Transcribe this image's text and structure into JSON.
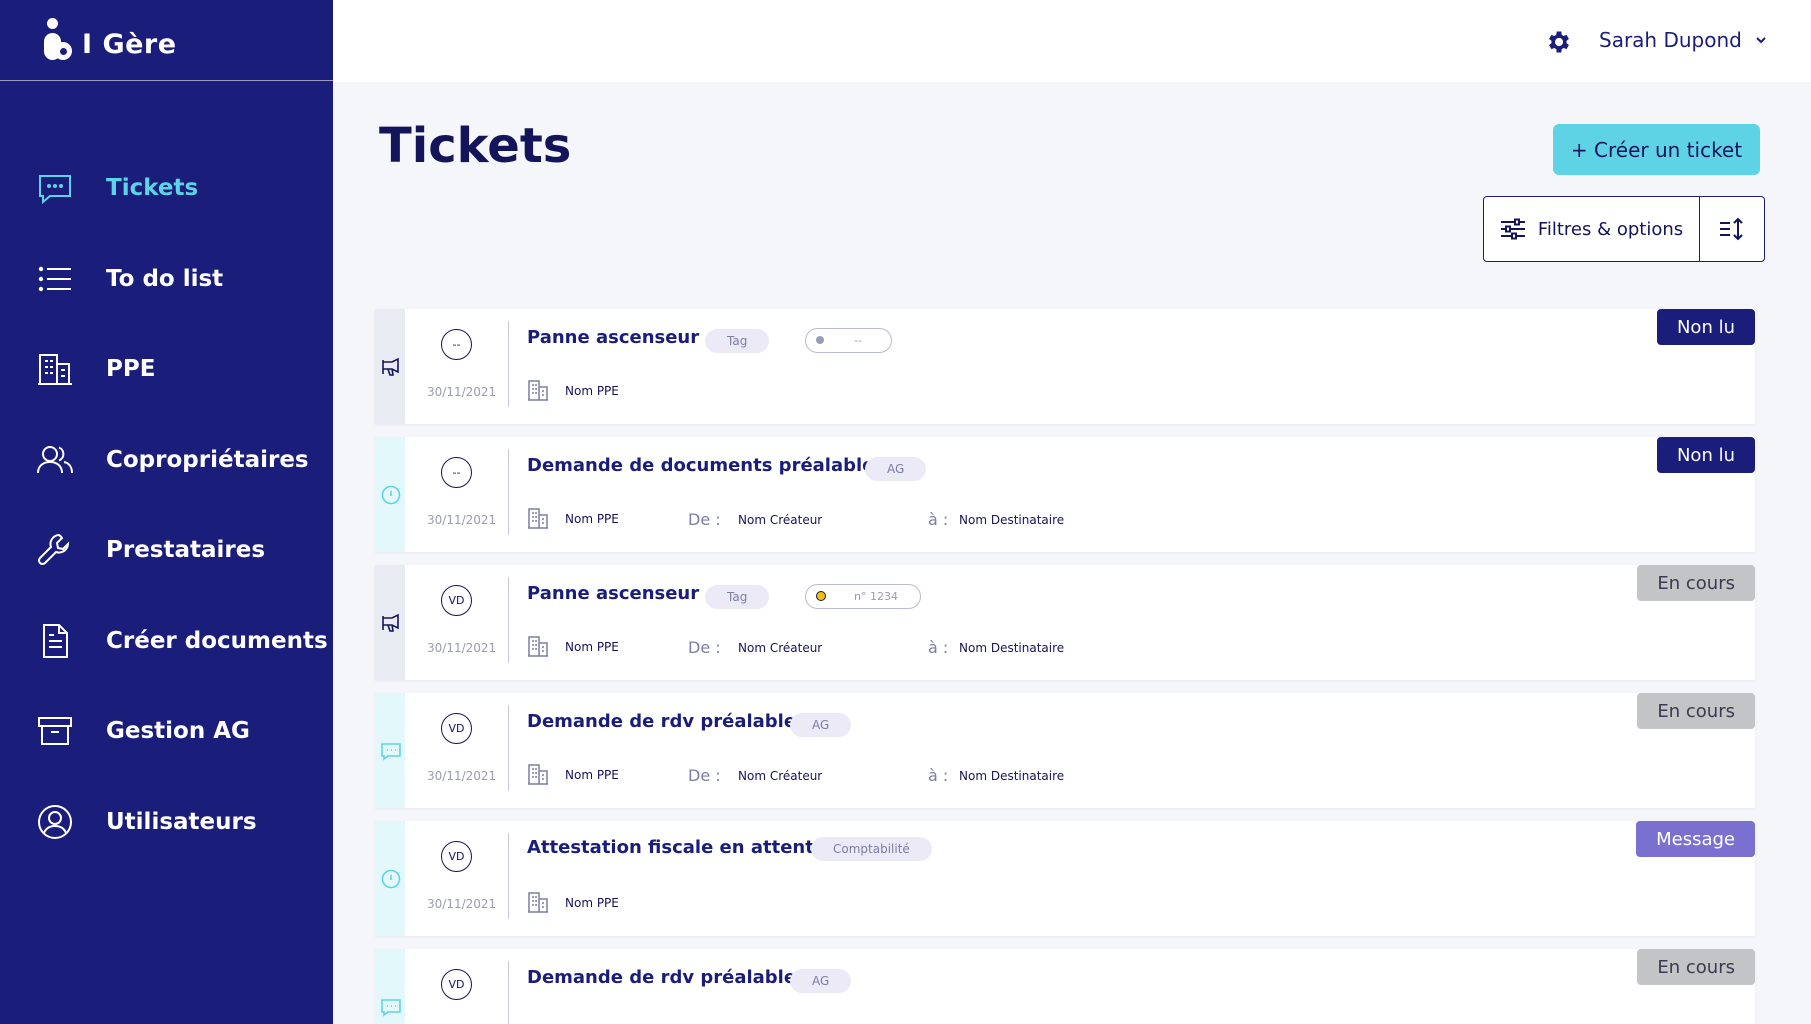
{
  "app": {
    "name": "I Gère"
  },
  "sidebar": {
    "items": [
      {
        "label": "Tickets",
        "icon": "chat-icon",
        "active": true
      },
      {
        "label": "To do list",
        "icon": "list-icon",
        "active": false
      },
      {
        "label": "PPE",
        "icon": "building-icon",
        "active": false
      },
      {
        "label": "Copropriétaires",
        "icon": "users-icon",
        "active": false
      },
      {
        "label": "Prestataires",
        "icon": "wrench-icon",
        "active": false
      },
      {
        "label": "Créer documents",
        "icon": "document-icon",
        "active": false
      },
      {
        "label": "Gestion AG",
        "icon": "archive-icon",
        "active": false
      },
      {
        "label": "Utilisateurs",
        "icon": "user-circle-icon",
        "active": false
      }
    ]
  },
  "header": {
    "user_name": "Sarah Dupond"
  },
  "main": {
    "title": "Tickets",
    "create_button": "+ Créer un ticket",
    "filter_button": "Filtres & options"
  },
  "labels": {
    "from": "De :",
    "to": "à :"
  },
  "colors": {
    "sidebar": "#1a1d7a",
    "accent": "#5fd3e6",
    "unread": "#1a1d7a",
    "in_progress": "#c3c4c6",
    "message": "#7a70d0"
  },
  "tickets": [
    {
      "avatar": "--",
      "date": "30/11/2021",
      "title": "Panne ascenseur",
      "tag": "Tag",
      "ref": "--",
      "ref_dot": "grey",
      "ppe": "Nom PPE",
      "from": "",
      "to": "",
      "status": "Non lu",
      "status_type": "unread",
      "strip_icon": "megaphone-icon"
    },
    {
      "avatar": "--",
      "date": "30/11/2021",
      "title": "Demande de documents préalable",
      "tag": "AG",
      "ref": "",
      "ppe": "Nom PPE",
      "from": "Nom Créateur",
      "to": "Nom Destinataire",
      "status": "Non lu",
      "status_type": "unread",
      "strip_icon": "info-icon"
    },
    {
      "avatar": "VD",
      "date": "30/11/2021",
      "title": "Panne ascenseur",
      "tag": "Tag",
      "ref": "n° 1234",
      "ref_dot": "yellow",
      "ppe": "Nom PPE",
      "from": "Nom Créateur",
      "to": "Nom Destinataire",
      "status": "En cours",
      "status_type": "progress",
      "strip_icon": "megaphone-icon"
    },
    {
      "avatar": "VD",
      "date": "30/11/2021",
      "title": "Demande de rdv préalable",
      "tag": "AG",
      "ref": "",
      "ppe": "Nom PPE",
      "from": "Nom Créateur",
      "to": "Nom Destinataire",
      "status": "En cours",
      "status_type": "progress",
      "strip_icon": "chat-icon"
    },
    {
      "avatar": "VD",
      "date": "30/11/2021",
      "title": "Attestation fiscale en attente",
      "tag": "Comptabilité",
      "ref": "",
      "ppe": "Nom PPE",
      "from": "",
      "to": "",
      "status": "Message",
      "status_type": "message",
      "strip_icon": "info-icon"
    },
    {
      "avatar": "VD",
      "date": "",
      "title": "Demande de rdv préalable",
      "tag": "AG",
      "ref": "",
      "ppe": "",
      "from": "",
      "to": "",
      "status": "En cours",
      "status_type": "progress",
      "strip_icon": "chat-icon"
    }
  ]
}
